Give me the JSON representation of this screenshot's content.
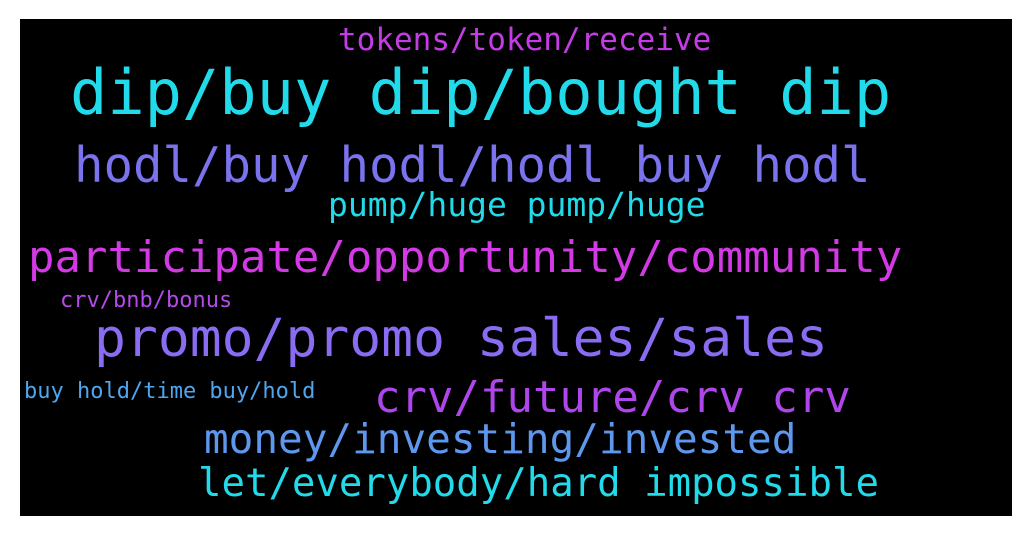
{
  "wordcloud": {
    "background": "#000000",
    "words": [
      {
        "id": "tokens",
        "text": "tokens/token/receive",
        "color": "#c43ce6"
      },
      {
        "id": "dip",
        "text": "dip/buy dip/bought dip",
        "color": "#22dbea"
      },
      {
        "id": "hodl",
        "text": "hodl/buy hodl/hodl buy hodl",
        "color": "#7b72ee"
      },
      {
        "id": "pump",
        "text": "pump/huge pump/huge",
        "color": "#22dbea"
      },
      {
        "id": "part",
        "text": "participate/opportunity/community",
        "color": "#d33ae6"
      },
      {
        "id": "crvbnb",
        "text": "crv/bnb/bonus",
        "color": "#b44ae8"
      },
      {
        "id": "promo",
        "text": "promo/promo sales/sales",
        "color": "#8a6cf2"
      },
      {
        "id": "buyhold",
        "text": "buy hold/time buy/hold",
        "color": "#4fa6ee"
      },
      {
        "id": "crvfut",
        "text": "crv/future/crv crv",
        "color": "#ae46ec"
      },
      {
        "id": "money",
        "text": "money/investing/invested",
        "color": "#5e98ee"
      },
      {
        "id": "let",
        "text": "let/everybody/hard impossible",
        "color": "#22dbea"
      }
    ]
  }
}
